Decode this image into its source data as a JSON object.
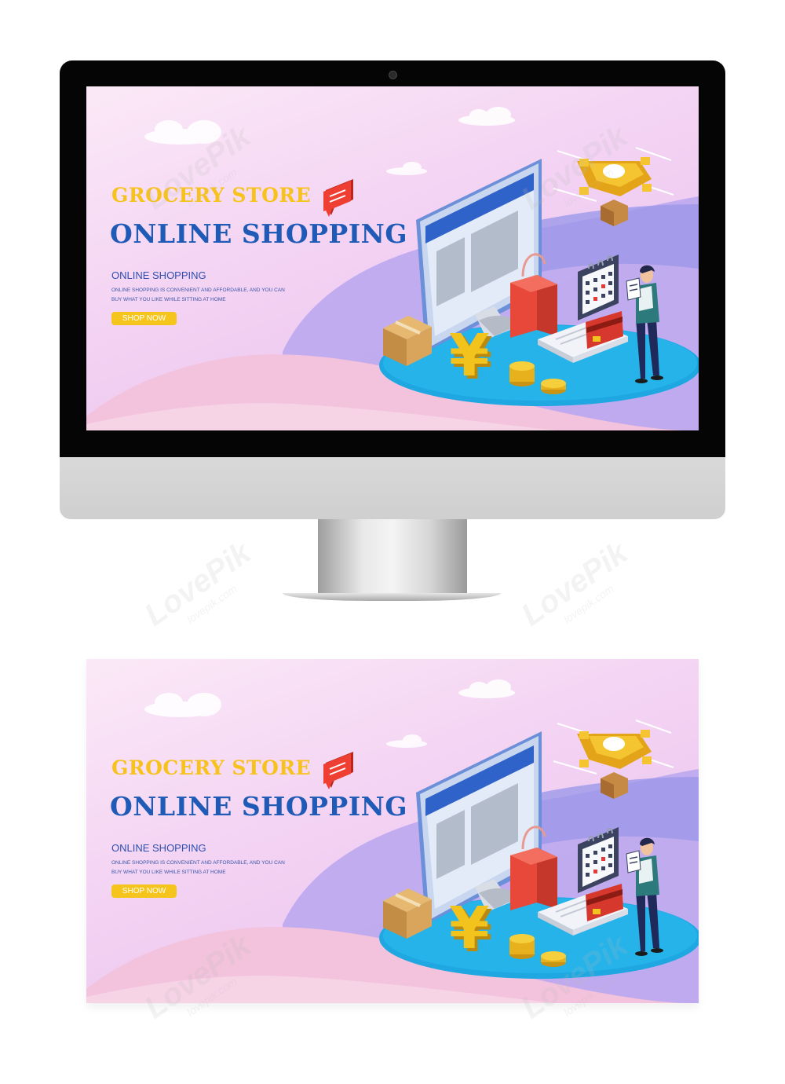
{
  "banner": {
    "title_yellow": "GROCERY STORE",
    "title_blue": "ONLINE SHOPPING",
    "subtitle": "ONLINE SHOPPING",
    "description": "ONLINE SHOPPING IS CONVENIENT AND AFFORDABLE, AND YOU CAN BUY WHAT YOU LIKE WHILE SITTING AT HOME",
    "cta_label": "SHOP NOW",
    "currency_symbol": "¥",
    "icons": [
      "cloud-icon",
      "chat-bubble-icon",
      "computer-monitor-icon",
      "drone-icon",
      "cardboard-box-icon",
      "shopping-bag-icon",
      "yen-symbol-icon",
      "coin-stack-icon",
      "calendar-icon",
      "credit-card-icon",
      "laptop-icon",
      "person-icon"
    ]
  },
  "watermark": {
    "brand": "LovePik",
    "site": "lovepik.com"
  },
  "colors": {
    "title_yellow": "#f7c21b",
    "title_blue": "#1f5bb6",
    "cta_background": "#f6c51d",
    "platform_blue": "#1ea7e1",
    "bag_red": "#ef4e3d",
    "bezel": "#050505",
    "chin": "#d3d3d3"
  }
}
